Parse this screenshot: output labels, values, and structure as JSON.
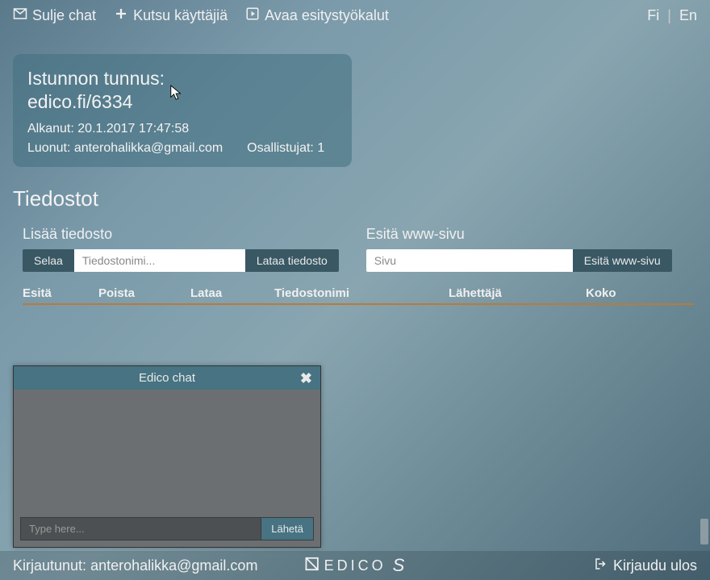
{
  "topbar": {
    "close_chat": "Sulje chat",
    "invite_users": "Kutsu käyttäjiä",
    "open_tools": "Avaa esitystyökalut",
    "lang_fi": "Fi",
    "lang_en": "En"
  },
  "session": {
    "title_label": "Istunnon tunnus:",
    "title_url": "edico.fi/6334",
    "started_label": "Alkanut:",
    "started_value": "20.1.2017 17:47:58",
    "creator_label": "Luonut:",
    "creator_value": "anterohalikka@gmail.com",
    "participants_label": "Osallistujat:",
    "participants_value": "1"
  },
  "files": {
    "section_title": "Tiedostot",
    "add_file_title": "Lisää tiedosto",
    "browse_btn": "Selaa",
    "filename_placeholder": "Tiedostonimi...",
    "upload_btn": "Lataa tiedosto",
    "present_title": "Esitä www-sivu",
    "page_placeholder": "Sivu",
    "present_btn": "Esitä www-sivu",
    "cols": {
      "present": "Esitä",
      "remove": "Poista",
      "download": "Lataa",
      "filename": "Tiedostonimi",
      "sender": "Lähettäjä",
      "size": "Koko"
    }
  },
  "chat": {
    "title": "Edico chat",
    "input_placeholder": "Type here...",
    "send_btn": "Lähetä"
  },
  "footer": {
    "logged_in_label": "Kirjautunut:",
    "logged_in_user": "anterohalikka@gmail.com",
    "brand": "EDICO",
    "brand_suffix": "S",
    "logout": "Kirjaudu ulos"
  }
}
